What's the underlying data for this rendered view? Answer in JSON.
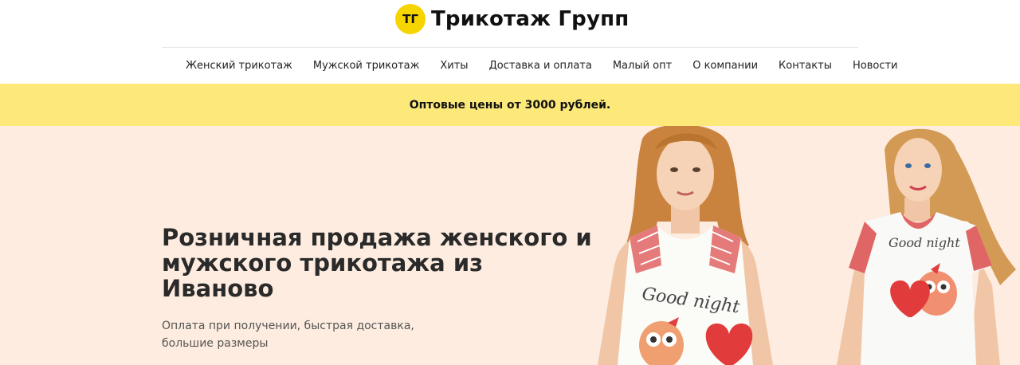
{
  "brand": {
    "badge": "ТГ",
    "name": "Трикотаж Групп",
    "badge_color": "#f5d400"
  },
  "nav": {
    "items": [
      {
        "label": "Женский трикотаж"
      },
      {
        "label": "Мужской трикотаж"
      },
      {
        "label": "Хиты"
      },
      {
        "label": "Доставка и оплата"
      },
      {
        "label": "Малый опт"
      },
      {
        "label": "О компании"
      },
      {
        "label": "Контакты"
      },
      {
        "label": "Новости"
      }
    ]
  },
  "promo": {
    "text": "Оптовые цены от 3000 рублей.",
    "background": "#fde97a"
  },
  "hero": {
    "title": "Розничная продажа женского и мужского трикотажа из Иваново",
    "subtitle": "Оплата при получении, быстрая доставка, большие размеры",
    "background": "#fdecdf",
    "photos": [
      {
        "shirt_text": "Good night",
        "depicts": "woman in sleeveless plaid-trim nightshirt with owl print"
      },
      {
        "shirt_text": "Good night",
        "depicts": "woman in short-sleeve plaid-trim nightshirt with owl print"
      }
    ]
  }
}
